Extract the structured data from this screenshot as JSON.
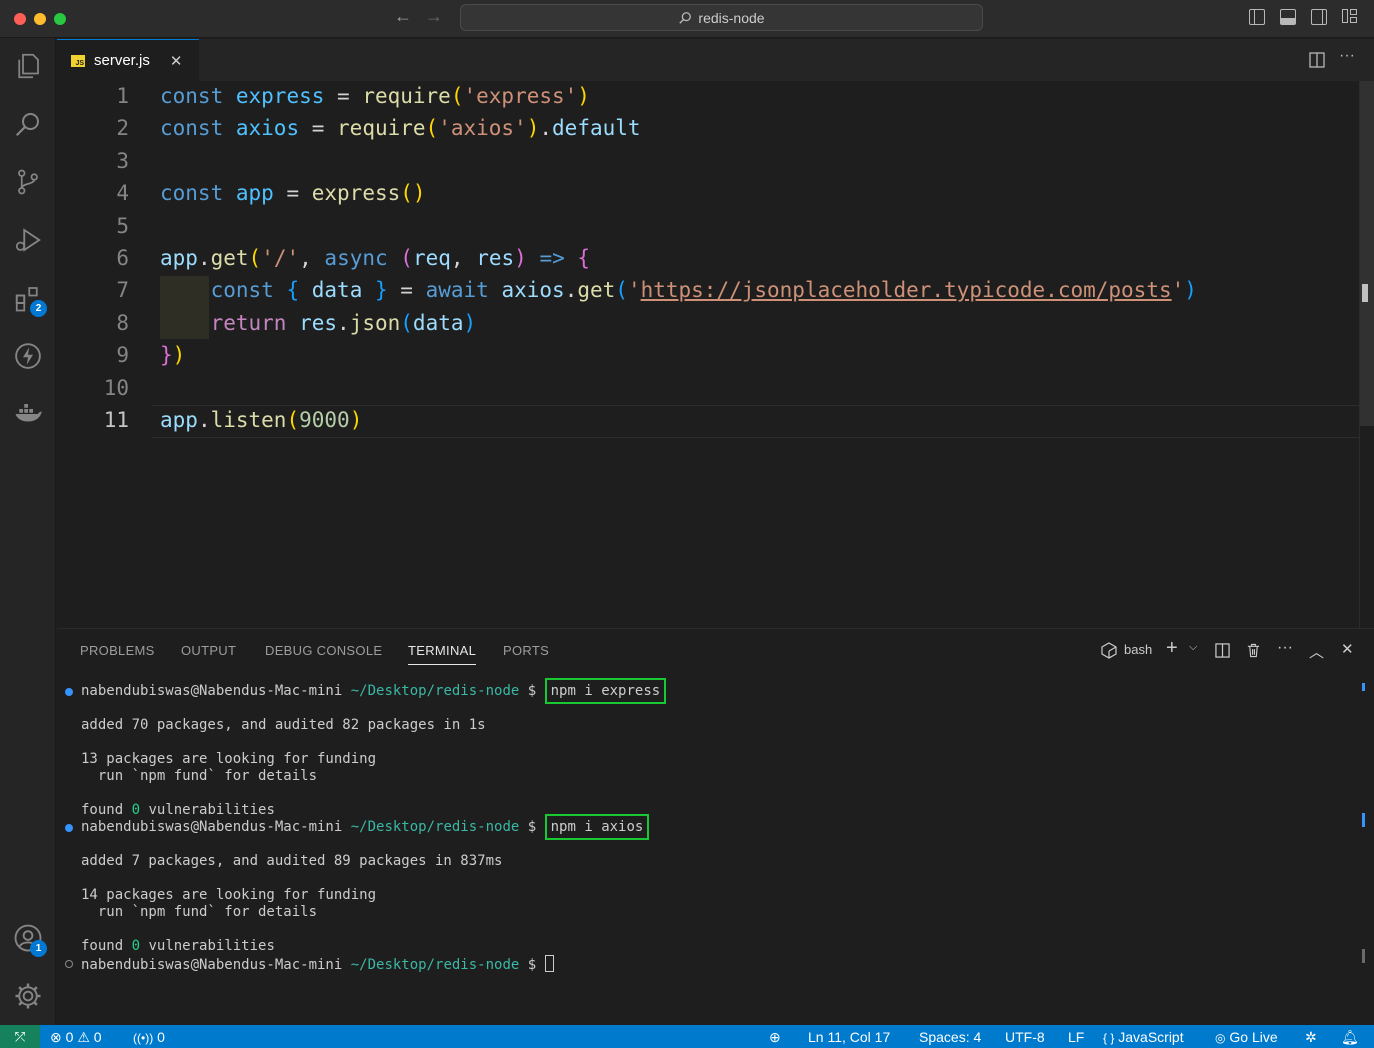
{
  "window": {
    "title": "redis-node"
  },
  "tab": {
    "icon_text": "JS",
    "label": "server.js",
    "close": "✕"
  },
  "activity": {
    "extensions_badge": "2",
    "accounts_badge": "1"
  },
  "editor": {
    "line_numbers": [
      "1",
      "2",
      "3",
      "4",
      "5",
      "6",
      "7",
      "8",
      "9",
      "10",
      "11"
    ],
    "lines": [
      "const express = require('express')",
      "const axios = require('axios').default",
      "",
      "const app = express()",
      "",
      "app.get('/', async (req, res) => {",
      "    const { data } = await axios.get('https://jsonplaceholder.typicode.com/posts')",
      "    return res.json(data)",
      "})",
      "",
      "app.listen(9000)"
    ]
  },
  "panel": {
    "tabs": [
      "PROBLEMS",
      "OUTPUT",
      "DEBUG CONSOLE",
      "TERMINAL",
      "PORTS"
    ],
    "active_tab": "TERMINAL",
    "shell": "bash",
    "prompt_user": "nabendubiswas@Nabendus-Mac-mini",
    "prompt_path": "~/Desktop/redis-node",
    "prompt_symbol": "$",
    "cmd1": "npm i express",
    "out1_line1": "added 70 packages, and audited 82 packages in 1s",
    "out1_line2": "13 packages are looking for funding",
    "out1_line3": "  run `npm fund` for details",
    "found_word": "found",
    "found_count": "0",
    "vuln_word": "vulnerabilities",
    "cmd2": "npm i axios",
    "out2_line1": "added 7 packages, and audited 89 packages in 837ms",
    "out2_line2": "14 packages are looking for funding",
    "out2_line3": "  run `npm fund` for details"
  },
  "status": {
    "errors": "0",
    "warnings": "0",
    "ports": "0",
    "position": "Ln 11, Col 17",
    "spaces": "Spaces: 4",
    "encoding": "UTF-8",
    "eol": "LF",
    "language": "JavaScript",
    "golive": "Go Live"
  },
  "colors": {
    "status_bar": "#007acc",
    "remote": "#16825d",
    "cmd_highlight": "#18c934"
  }
}
